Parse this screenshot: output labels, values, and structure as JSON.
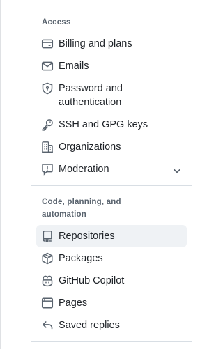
{
  "sidebar": {
    "sections": [
      {
        "heading": "Access",
        "items": [
          {
            "label": "Billing and plans",
            "icon": "credit-card-icon"
          },
          {
            "label": "Emails",
            "icon": "mail-icon"
          },
          {
            "label": "Password and authentication",
            "icon": "shield-lock-icon"
          },
          {
            "label": "SSH and GPG keys",
            "icon": "key-icon"
          },
          {
            "label": "Organizations",
            "icon": "organization-icon"
          },
          {
            "label": "Moderation",
            "icon": "report-icon",
            "expandable": true,
            "expand_icon": "chevron-down-icon"
          }
        ]
      },
      {
        "heading": "Code, planning, and automation",
        "items": [
          {
            "label": "Repositories",
            "icon": "repo-icon",
            "selected": true
          },
          {
            "label": "Packages",
            "icon": "package-icon"
          },
          {
            "label": "GitHub Copilot",
            "icon": "copilot-icon"
          },
          {
            "label": "Pages",
            "icon": "browser-icon"
          },
          {
            "label": "Saved replies",
            "icon": "reply-icon"
          }
        ]
      }
    ]
  },
  "colors": {
    "text": "#1f2328",
    "muted": "#59636e",
    "divider": "#d8dee4",
    "selected_bg": "#eff2f5"
  }
}
